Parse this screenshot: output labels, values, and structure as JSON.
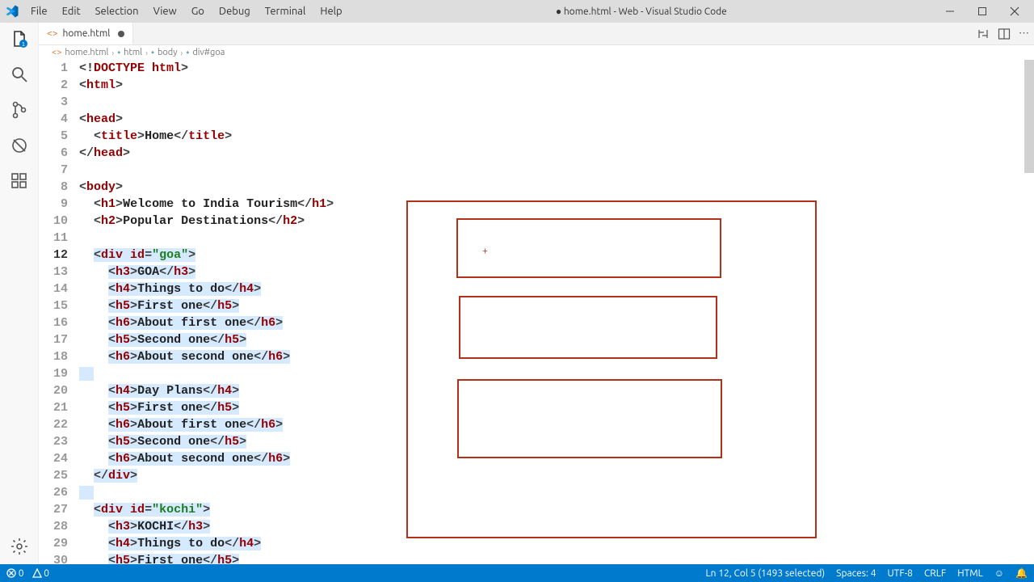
{
  "menu": {
    "items": [
      "File",
      "Edit",
      "Selection",
      "View",
      "Go",
      "Debug",
      "Terminal",
      "Help"
    ]
  },
  "title": "● home.html - Web - Visual Studio Code",
  "tab": {
    "name": "home.html",
    "dirty": true
  },
  "breadcrumb": {
    "file": "home.html",
    "parts": [
      "html",
      "body",
      "div#goa"
    ]
  },
  "status": {
    "errors": "0",
    "warnings": "0",
    "position": "Ln 12, Col 5 (1493 selected)",
    "spaces": "Spaces: 4",
    "encoding": "UTF-8",
    "eol": "CRLF",
    "lang": "HTML"
  },
  "code": {
    "lines": [
      {
        "n": 1,
        "indent": 0,
        "sel": false,
        "tokens": [
          [
            "<!",
            "p"
          ],
          [
            "DOCTYPE html",
            "doct"
          ],
          [
            ">",
            "p"
          ]
        ]
      },
      {
        "n": 2,
        "indent": 0,
        "sel": false,
        "tokens": [
          [
            "<",
            "p"
          ],
          [
            "html",
            "kw"
          ],
          [
            ">",
            "p"
          ]
        ]
      },
      {
        "n": 3,
        "indent": 0,
        "sel": false,
        "tokens": []
      },
      {
        "n": 4,
        "indent": 0,
        "sel": false,
        "tokens": [
          [
            "<",
            "p"
          ],
          [
            "head",
            "kw"
          ],
          [
            ">",
            "p"
          ]
        ]
      },
      {
        "n": 5,
        "indent": 1,
        "sel": false,
        "tokens": [
          [
            "<",
            "p"
          ],
          [
            "title",
            "kw"
          ],
          [
            ">",
            "p"
          ],
          [
            "Home",
            "txt"
          ],
          [
            "</",
            "p"
          ],
          [
            "title",
            "kw"
          ],
          [
            ">",
            "p"
          ]
        ]
      },
      {
        "n": 6,
        "indent": 0,
        "sel": false,
        "tokens": [
          [
            "</",
            "p"
          ],
          [
            "head",
            "kw"
          ],
          [
            ">",
            "p"
          ]
        ]
      },
      {
        "n": 7,
        "indent": 0,
        "sel": false,
        "tokens": []
      },
      {
        "n": 8,
        "indent": 0,
        "sel": false,
        "tokens": [
          [
            "<",
            "p"
          ],
          [
            "body",
            "kw"
          ],
          [
            ">",
            "p"
          ]
        ]
      },
      {
        "n": 9,
        "indent": 1,
        "sel": false,
        "tokens": [
          [
            "<",
            "p"
          ],
          [
            "h1",
            "kw"
          ],
          [
            ">",
            "p"
          ],
          [
            "Welcome to India Tourism",
            "txt"
          ],
          [
            "</",
            "p"
          ],
          [
            "h1",
            "kw"
          ],
          [
            ">",
            "p"
          ]
        ]
      },
      {
        "n": 10,
        "indent": 1,
        "sel": false,
        "tokens": [
          [
            "<",
            "p"
          ],
          [
            "h2",
            "kw"
          ],
          [
            ">",
            "p"
          ],
          [
            "Popular Destinations",
            "txt"
          ],
          [
            "</",
            "p"
          ],
          [
            "h2",
            "kw"
          ],
          [
            ">",
            "p"
          ]
        ]
      },
      {
        "n": 11,
        "indent": 0,
        "sel": false,
        "tokens": []
      },
      {
        "n": 12,
        "indent": 1,
        "sel": true,
        "active": true,
        "tokens": [
          [
            "<",
            "p"
          ],
          [
            "div ",
            "kw"
          ],
          [
            "id",
            "attr"
          ],
          [
            "=",
            "p"
          ],
          [
            "\"goa\"",
            "str"
          ],
          [
            ">",
            "p"
          ]
        ]
      },
      {
        "n": 13,
        "indent": 2,
        "sel": true,
        "tokens": [
          [
            "<",
            "p"
          ],
          [
            "h3",
            "kw"
          ],
          [
            ">",
            "p"
          ],
          [
            "GOA",
            "txt"
          ],
          [
            "</",
            "p"
          ],
          [
            "h3",
            "kw"
          ],
          [
            ">",
            "p"
          ]
        ]
      },
      {
        "n": 14,
        "indent": 2,
        "sel": true,
        "tokens": [
          [
            "<",
            "p"
          ],
          [
            "h4",
            "kw"
          ],
          [
            ">",
            "p"
          ],
          [
            "Things to do",
            "txt"
          ],
          [
            "</",
            "p"
          ],
          [
            "h4",
            "kw"
          ],
          [
            ">",
            "p"
          ]
        ]
      },
      {
        "n": 15,
        "indent": 2,
        "sel": true,
        "tokens": [
          [
            "<",
            "p"
          ],
          [
            "h5",
            "kw"
          ],
          [
            ">",
            "p"
          ],
          [
            "First one",
            "txt"
          ],
          [
            "</",
            "p"
          ],
          [
            "h5",
            "kw"
          ],
          [
            ">",
            "p"
          ]
        ]
      },
      {
        "n": 16,
        "indent": 2,
        "sel": true,
        "tokens": [
          [
            "<",
            "p"
          ],
          [
            "h6",
            "kw"
          ],
          [
            ">",
            "p"
          ],
          [
            "About first one",
            "txt"
          ],
          [
            "</",
            "p"
          ],
          [
            "h6",
            "kw"
          ],
          [
            ">",
            "p"
          ]
        ]
      },
      {
        "n": 17,
        "indent": 2,
        "sel": true,
        "tokens": [
          [
            "<",
            "p"
          ],
          [
            "h5",
            "kw"
          ],
          [
            ">",
            "p"
          ],
          [
            "Second one",
            "txt"
          ],
          [
            "</",
            "p"
          ],
          [
            "h5",
            "kw"
          ],
          [
            ">",
            "p"
          ]
        ]
      },
      {
        "n": 18,
        "indent": 2,
        "sel": true,
        "tokens": [
          [
            "<",
            "p"
          ],
          [
            "h6",
            "kw"
          ],
          [
            ">",
            "p"
          ],
          [
            "About second one",
            "txt"
          ],
          [
            "</",
            "p"
          ],
          [
            "h6",
            "kw"
          ],
          [
            ">",
            "p"
          ]
        ]
      },
      {
        "n": 19,
        "indent": 0,
        "sel": true,
        "tokens": []
      },
      {
        "n": 20,
        "indent": 2,
        "sel": true,
        "tokens": [
          [
            "<",
            "p"
          ],
          [
            "h4",
            "kw"
          ],
          [
            ">",
            "p"
          ],
          [
            "Day Plans",
            "txt"
          ],
          [
            "</",
            "p"
          ],
          [
            "h4",
            "kw"
          ],
          [
            ">",
            "p"
          ]
        ]
      },
      {
        "n": 21,
        "indent": 2,
        "sel": true,
        "tokens": [
          [
            "<",
            "p"
          ],
          [
            "h5",
            "kw"
          ],
          [
            ">",
            "p"
          ],
          [
            "First one",
            "txt"
          ],
          [
            "</",
            "p"
          ],
          [
            "h5",
            "kw"
          ],
          [
            ">",
            "p"
          ]
        ]
      },
      {
        "n": 22,
        "indent": 2,
        "sel": true,
        "tokens": [
          [
            "<",
            "p"
          ],
          [
            "h6",
            "kw"
          ],
          [
            ">",
            "p"
          ],
          [
            "About first one",
            "txt"
          ],
          [
            "</",
            "p"
          ],
          [
            "h6",
            "kw"
          ],
          [
            ">",
            "p"
          ]
        ]
      },
      {
        "n": 23,
        "indent": 2,
        "sel": true,
        "tokens": [
          [
            "<",
            "p"
          ],
          [
            "h5",
            "kw"
          ],
          [
            ">",
            "p"
          ],
          [
            "Second one",
            "txt"
          ],
          [
            "</",
            "p"
          ],
          [
            "h5",
            "kw"
          ],
          [
            ">",
            "p"
          ]
        ]
      },
      {
        "n": 24,
        "indent": 2,
        "sel": true,
        "tokens": [
          [
            "<",
            "p"
          ],
          [
            "h6",
            "kw"
          ],
          [
            ">",
            "p"
          ],
          [
            "About second one",
            "txt"
          ],
          [
            "</",
            "p"
          ],
          [
            "h6",
            "kw"
          ],
          [
            ">",
            "p"
          ]
        ]
      },
      {
        "n": 25,
        "indent": 1,
        "sel": true,
        "tokens": [
          [
            "</",
            "p"
          ],
          [
            "div",
            "kw"
          ],
          [
            ">",
            "p"
          ]
        ]
      },
      {
        "n": 26,
        "indent": 0,
        "sel": true,
        "tokens": []
      },
      {
        "n": 27,
        "indent": 1,
        "sel": true,
        "tokens": [
          [
            "<",
            "p"
          ],
          [
            "div ",
            "kw"
          ],
          [
            "id",
            "attr"
          ],
          [
            "=",
            "p"
          ],
          [
            "\"kochi\"",
            "str"
          ],
          [
            ">",
            "p"
          ]
        ]
      },
      {
        "n": 28,
        "indent": 2,
        "sel": true,
        "tokens": [
          [
            "<",
            "p"
          ],
          [
            "h3",
            "kw"
          ],
          [
            ">",
            "p"
          ],
          [
            "KOCHI",
            "txt"
          ],
          [
            "</",
            "p"
          ],
          [
            "h3",
            "kw"
          ],
          [
            ">",
            "p"
          ]
        ]
      },
      {
        "n": 29,
        "indent": 2,
        "sel": true,
        "tokens": [
          [
            "<",
            "p"
          ],
          [
            "h4",
            "kw"
          ],
          [
            ">",
            "p"
          ],
          [
            "Things to do",
            "txt"
          ],
          [
            "</",
            "p"
          ],
          [
            "h4",
            "kw"
          ],
          [
            ">",
            "p"
          ]
        ]
      },
      {
        "n": 30,
        "indent": 2,
        "sel": true,
        "tokens": [
          [
            "<",
            "p"
          ],
          [
            "h5",
            "kw"
          ],
          [
            ">",
            "p"
          ],
          [
            "First one",
            "txt"
          ],
          [
            "</",
            "p"
          ],
          [
            "h5",
            "kw"
          ],
          [
            ">",
            "p"
          ]
        ]
      }
    ]
  }
}
